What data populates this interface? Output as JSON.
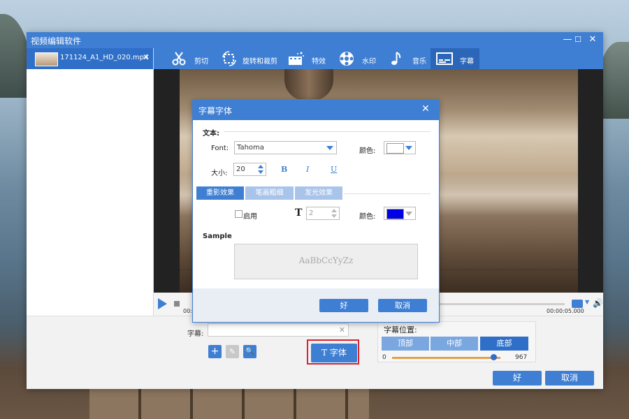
{
  "window": {
    "title": "视频编辑软件",
    "minimize": "—",
    "maximize": "☐",
    "close": "✕"
  },
  "file": {
    "name": "171124_A1_HD_020.mp4",
    "close": "✕"
  },
  "tabs": [
    {
      "label": "剪切",
      "icon": "scissors-icon"
    },
    {
      "label": "旋转和裁剪",
      "icon": "crop-rotate-icon"
    },
    {
      "label": "特效",
      "icon": "effects-icon"
    },
    {
      "label": "水印",
      "icon": "watermark-icon"
    },
    {
      "label": "音乐",
      "icon": "music-icon"
    },
    {
      "label": "字幕",
      "icon": "subtitle-icon",
      "active": true
    }
  ],
  "player": {
    "time_start": "00:",
    "time_end": "00:00:05.000"
  },
  "subtitle_panel": {
    "label": "字幕:",
    "input_value": "",
    "clear": "✕",
    "add": "+",
    "edit": "✎",
    "search": "🔍",
    "font_button": "字体",
    "font_icon": "T"
  },
  "position": {
    "title": "字幕位置:",
    "options": [
      "顶部",
      "中部",
      "底部"
    ],
    "selected": "底部",
    "min": "0",
    "max": "967",
    "value_fraction": 0.94
  },
  "window_buttons": {
    "ok": "好",
    "cancel": "取消"
  },
  "dialog": {
    "title": "字幕字体",
    "close": "✕",
    "text_section": "文本:",
    "font_label": "Font:",
    "font_value": "Tahoma",
    "color_label": "颜色:",
    "text_color": "#ffffff",
    "size_label": "大小:",
    "size_value": "20",
    "bold": "B",
    "italic": "I",
    "underline": "U",
    "effect_tabs": [
      "重影效果",
      "笔画粗细",
      "发光效果"
    ],
    "effect_selected": "重影效果",
    "enable_label": "启用",
    "enabled": false,
    "shadow_value": "2",
    "shadow_color_label": "颜色:",
    "shadow_color": "#0000e6",
    "sample_label": "Sample",
    "sample_text": "AaBbCcYyZz",
    "ok": "好",
    "cancel": "取消"
  },
  "colors": {
    "accent": "#3f7fd3",
    "accent_dark": "#2f6fc7",
    "highlight": "#d9232d"
  }
}
